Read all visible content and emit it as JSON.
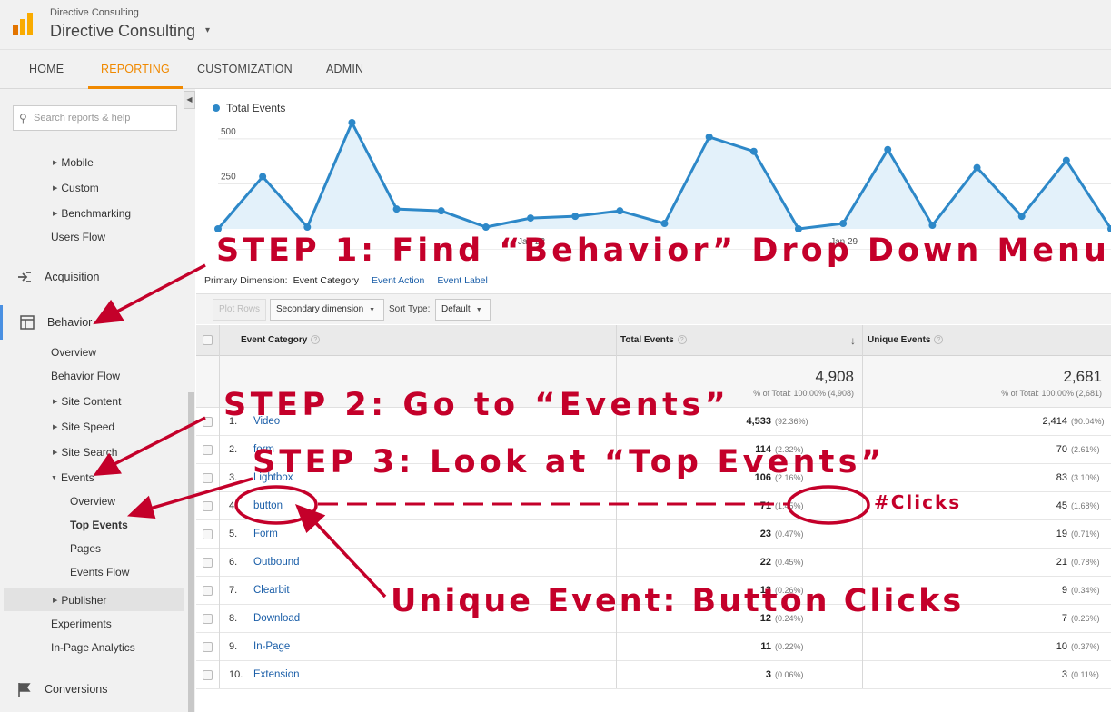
{
  "header": {
    "account_sub": "Directive Consulting",
    "account_main": "Directive Consulting",
    "caret": "▾"
  },
  "nav": {
    "tabs": [
      {
        "label": "HOME"
      },
      {
        "label": "REPORTING"
      },
      {
        "label": "CUSTOMIZATION"
      },
      {
        "label": "ADMIN"
      }
    ],
    "active_tab": "REPORTING"
  },
  "sidebar": {
    "search_placeholder": "Search reports & help",
    "items": {
      "mobile": "Mobile",
      "custom": "Custom",
      "benchmarking": "Benchmarking",
      "users_flow": "Users Flow",
      "acquisition": "Acquisition",
      "behavior": "Behavior",
      "overview": "Overview",
      "behavior_flow": "Behavior Flow",
      "site_content": "Site Content",
      "site_speed": "Site Speed",
      "site_search": "Site Search",
      "events": "Events",
      "events_overview": "Overview",
      "top_events": "Top Events",
      "pages": "Pages",
      "events_flow": "Events Flow",
      "publisher": "Publisher",
      "experiments": "Experiments",
      "in_page_analytics": "In-Page Analytics",
      "conversions": "Conversions"
    }
  },
  "chart_data": {
    "type": "area",
    "series": [
      {
        "name": "Total Events",
        "values": [
          0,
          290,
          10,
          590,
          110,
          100,
          10,
          60,
          70,
          100,
          30,
          510,
          430,
          0,
          30,
          440,
          20,
          340,
          70,
          380,
          0
        ]
      }
    ],
    "x_tick_labels": [
      "Jan 22",
      "Jan 29"
    ],
    "y_ticks": [
      250,
      500
    ],
    "ylim": [
      0,
      600
    ],
    "grid": true,
    "legend": "top-left",
    "color": "#2d88c8"
  },
  "dimension_bar": {
    "label": "Primary Dimension:",
    "active": "Event Category",
    "link_action": "Event Action",
    "link_label": "Event Label"
  },
  "toolbar": {
    "plot_rows": "Plot Rows",
    "secondary_dimension": "Secondary dimension",
    "sort_type_label": "Sort Type:",
    "sort_type_value": "Default"
  },
  "table": {
    "headers": {
      "event_category": "Event Category",
      "total_events": "Total Events",
      "unique_events": "Unique Events"
    },
    "sort_arrow": "↓",
    "totals": {
      "total_events": "4,908",
      "total_events_pct": "% of Total: 100.00% (4,908)",
      "unique_events": "2,681",
      "unique_events_pct": "% of Total: 100.00% (2,681)"
    },
    "rows": [
      {
        "num": "1.",
        "category": "Video",
        "total": "4,533",
        "total_pct": "(92.36%)",
        "unique": "2,414",
        "unique_pct": "(90.04%)"
      },
      {
        "num": "2.",
        "category": "form",
        "total": "114",
        "total_pct": "(2.32%)",
        "unique": "70",
        "unique_pct": "(2.61%)"
      },
      {
        "num": "3.",
        "category": "Lightbox",
        "total": "106",
        "total_pct": "(2.16%)",
        "unique": "83",
        "unique_pct": "(3.10%)"
      },
      {
        "num": "4.",
        "category": "button",
        "total": "71",
        "total_pct": "(1.45%)",
        "unique": "45",
        "unique_pct": "(1.68%)"
      },
      {
        "num": "5.",
        "category": "Form",
        "total": "23",
        "total_pct": "(0.47%)",
        "unique": "19",
        "unique_pct": "(0.71%)"
      },
      {
        "num": "6.",
        "category": "Outbound",
        "total": "22",
        "total_pct": "(0.45%)",
        "unique": "21",
        "unique_pct": "(0.78%)"
      },
      {
        "num": "7.",
        "category": "Clearbit",
        "total": "13",
        "total_pct": "(0.26%)",
        "unique": "9",
        "unique_pct": "(0.34%)"
      },
      {
        "num": "8.",
        "category": "Download",
        "total": "12",
        "total_pct": "(0.24%)",
        "unique": "7",
        "unique_pct": "(0.26%)"
      },
      {
        "num": "9.",
        "category": "In-Page",
        "total": "11",
        "total_pct": "(0.22%)",
        "unique": "10",
        "unique_pct": "(0.37%)"
      },
      {
        "num": "10.",
        "category": "Extension",
        "total": "3",
        "total_pct": "(0.06%)",
        "unique": "3",
        "unique_pct": "(0.11%)"
      }
    ]
  },
  "annotations": {
    "step1": "STEP 1: Find “Behavior” Drop Down Menu",
    "step2": "STEP 2: Go to “Events”",
    "step3": "STEP 3: Look at “Top Events”",
    "clicks": "#Clicks",
    "unique_event": "Unique Event: Button Clicks",
    "color": "#c4002a"
  }
}
